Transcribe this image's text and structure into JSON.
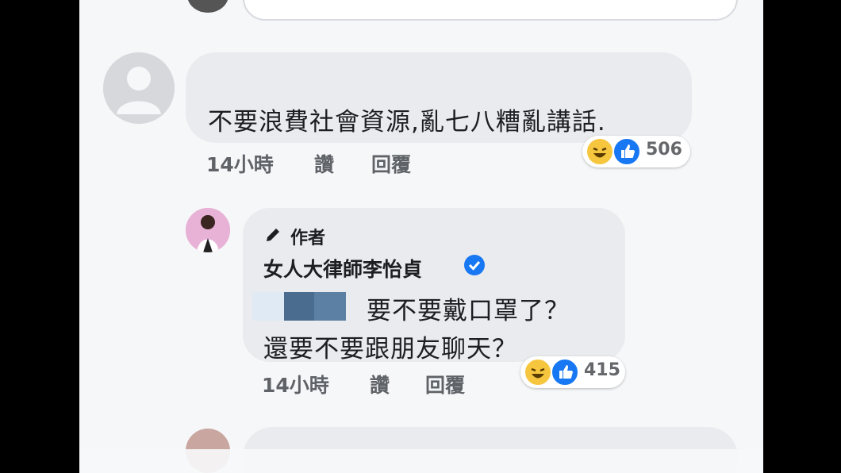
{
  "comments": [
    {
      "author": "",
      "text": "不要浪費社會資源,亂七八糟亂講話.",
      "time": "14小時",
      "like_label": "讚",
      "reply_label": "回覆",
      "reactions": [
        "haha",
        "like"
      ],
      "reaction_count": "506"
    },
    {
      "author_badge": "作者",
      "author": "女人大律師李怡貞",
      "verified": true,
      "text_line1": "要不要戴口罩了？",
      "text_line2": "還要不要跟朋友聊天？",
      "time": "14小時",
      "like_label": "讚",
      "reply_label": "回覆",
      "reactions": [
        "haha",
        "like"
      ],
      "reaction_count": "415"
    }
  ],
  "colors": {
    "bubble": "#e9ebee",
    "like_blue": "#1877f2",
    "haha_yellow": "#f7c63f",
    "verified_blue": "#1877f2"
  }
}
